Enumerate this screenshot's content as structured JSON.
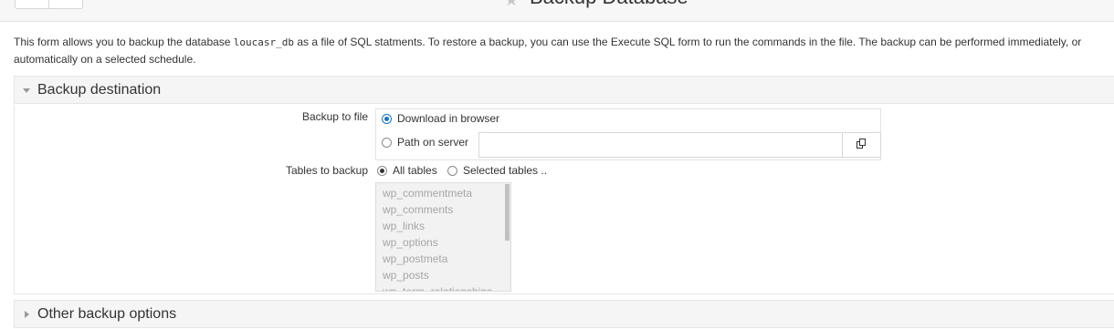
{
  "header": {
    "title": "Backup Database",
    "nav_buttons": [
      "",
      ""
    ]
  },
  "description": {
    "line1_prefix": "This form allows you to backup the database ",
    "db_name": "loucasr_db",
    "line1_suffix": " as a file of SQL statments. To restore a backup, you can use the Execute SQL form to run the commands in the file. The backup can be performed immediately, or",
    "line2": "automatically on a selected schedule."
  },
  "sections": {
    "destination": {
      "title": "Backup destination",
      "expanded": true
    },
    "other": {
      "title": "Other backup options",
      "expanded": false
    }
  },
  "backup_to_file": {
    "label": "Backup to file",
    "options": [
      {
        "label": "Download in browser",
        "selected": true
      },
      {
        "label": "Path on server",
        "selected": false
      }
    ],
    "path_value": ""
  },
  "tables_to_backup": {
    "label": "Tables to backup",
    "options": [
      {
        "label": "All tables",
        "selected": true
      },
      {
        "label": "Selected tables ..",
        "selected": false
      }
    ],
    "tables": [
      "wp_commentmeta",
      "wp_comments",
      "wp_links",
      "wp_options",
      "wp_postmeta",
      "wp_posts",
      "wp_term_relationships"
    ]
  },
  "colors": {
    "accent": "#1a73c7",
    "panel_header": "#f5f5f5",
    "disabled_text": "#a6a6a6"
  },
  "icons": {
    "title": "star-icon",
    "chooser": "file-chooser-icon"
  }
}
